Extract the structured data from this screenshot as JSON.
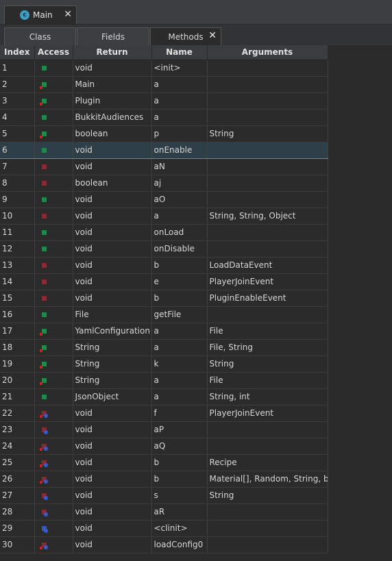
{
  "document_tab": {
    "icon": "class-icon",
    "icon_letter": "c",
    "label": "Main",
    "close": "✕"
  },
  "subtabs": [
    {
      "label": "Class"
    },
    {
      "label": "Fields"
    },
    {
      "label": "Methods",
      "active": true,
      "close": "✕"
    }
  ],
  "columns": [
    "Index",
    "Access",
    "Return",
    "Name",
    "Arguments"
  ],
  "rows": [
    {
      "index": "1",
      "access": "public",
      "ret": "void",
      "name": "<init>",
      "args": ""
    },
    {
      "index": "2",
      "access": "public-static",
      "ret": "Main",
      "name": "a",
      "args": ""
    },
    {
      "index": "3",
      "access": "public-static",
      "ret": "Plugin",
      "name": "a",
      "args": ""
    },
    {
      "index": "4",
      "access": "public",
      "ret": "BukkitAudiences",
      "name": "a",
      "args": ""
    },
    {
      "index": "5",
      "access": "public-static",
      "ret": "boolean",
      "name": "p",
      "args": "String"
    },
    {
      "index": "6",
      "access": "public",
      "ret": "void",
      "name": "onEnable",
      "args": "",
      "selected": true
    },
    {
      "index": "7",
      "access": "private",
      "ret": "void",
      "name": "aN",
      "args": ""
    },
    {
      "index": "8",
      "access": "private",
      "ret": "boolean",
      "name": "aj",
      "args": ""
    },
    {
      "index": "9",
      "access": "public",
      "ret": "void",
      "name": "aO",
      "args": ""
    },
    {
      "index": "10",
      "access": "private",
      "ret": "void",
      "name": "a",
      "args": "String, String, Object"
    },
    {
      "index": "11",
      "access": "public",
      "ret": "void",
      "name": "onLoad",
      "args": ""
    },
    {
      "index": "12",
      "access": "public",
      "ret": "void",
      "name": "onDisable",
      "args": ""
    },
    {
      "index": "13",
      "access": "private",
      "ret": "void",
      "name": "b",
      "args": "LoadDataEvent"
    },
    {
      "index": "14",
      "access": "private",
      "ret": "void",
      "name": "e",
      "args": "PlayerJoinEvent"
    },
    {
      "index": "15",
      "access": "private",
      "ret": "void",
      "name": "b",
      "args": "PluginEnableEvent"
    },
    {
      "index": "16",
      "access": "public",
      "ret": "File",
      "name": "getFile",
      "args": ""
    },
    {
      "index": "17",
      "access": "public-static",
      "ret": "YamlConfiguration",
      "name": "a",
      "args": "File"
    },
    {
      "index": "18",
      "access": "public-static",
      "ret": "String",
      "name": "a",
      "args": "File, String"
    },
    {
      "index": "19",
      "access": "public-static",
      "ret": "String",
      "name": "k",
      "args": "String"
    },
    {
      "index": "20",
      "access": "public-static",
      "ret": "String",
      "name": "a",
      "args": "File"
    },
    {
      "index": "21",
      "access": "public",
      "ret": "JsonObject",
      "name": "a",
      "args": "String, int"
    },
    {
      "index": "22",
      "access": "private-static-synthetic",
      "ret": "void",
      "name": "f",
      "args": "PlayerJoinEvent"
    },
    {
      "index": "23",
      "access": "private-synthetic",
      "ret": "void",
      "name": "aP",
      "args": ""
    },
    {
      "index": "24",
      "access": "private-static-synthetic",
      "ret": "void",
      "name": "aQ",
      "args": ""
    },
    {
      "index": "25",
      "access": "private-static-synthetic",
      "ret": "void",
      "name": "b",
      "args": "Recipe"
    },
    {
      "index": "26",
      "access": "private-static-synthetic",
      "ret": "void",
      "name": "b",
      "args": "Material[], Random, String, bo"
    },
    {
      "index": "27",
      "access": "private-synthetic",
      "ret": "void",
      "name": "s",
      "args": "String"
    },
    {
      "index": "28",
      "access": "private-synthetic",
      "ret": "void",
      "name": "aR",
      "args": ""
    },
    {
      "index": "29",
      "access": "static-synthetic",
      "ret": "void",
      "name": "<clinit>",
      "args": ""
    },
    {
      "index": "30",
      "access": "private-static-synthetic",
      "ret": "void",
      "name": "loadConfig0",
      "args": ""
    }
  ],
  "colors": {
    "public": "#1f8a46",
    "private": "#8a2a30",
    "static": "#d02020",
    "synthetic": "#3a5bd0",
    "selection": "#2f3f47"
  }
}
